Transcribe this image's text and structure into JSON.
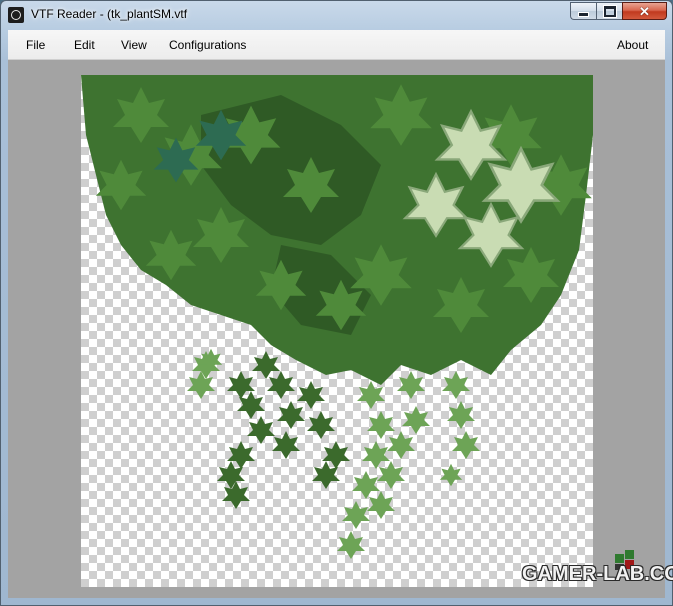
{
  "window": {
    "title": "VTF Reader - (tk_plantSM.vtf",
    "icon": "camera-app-icon",
    "controls": {
      "minimize": "minimize",
      "maximize": "maximize",
      "close": "close"
    }
  },
  "menu": {
    "items": [
      "File",
      "Edit",
      "View",
      "Configurations"
    ],
    "about": "About"
  },
  "image": {
    "description_icon": "texture-preview",
    "background": "checkerboard-transparency"
  },
  "watermark": "GAMER-LAB.COM",
  "colors": {
    "leaf_dark": "#2f5a25",
    "leaf_mid": "#4f8a3a",
    "leaf_light": "#8fbf6a",
    "leaf_variegated": "#d9e6c8",
    "client_bg": "#a3a3a3"
  }
}
